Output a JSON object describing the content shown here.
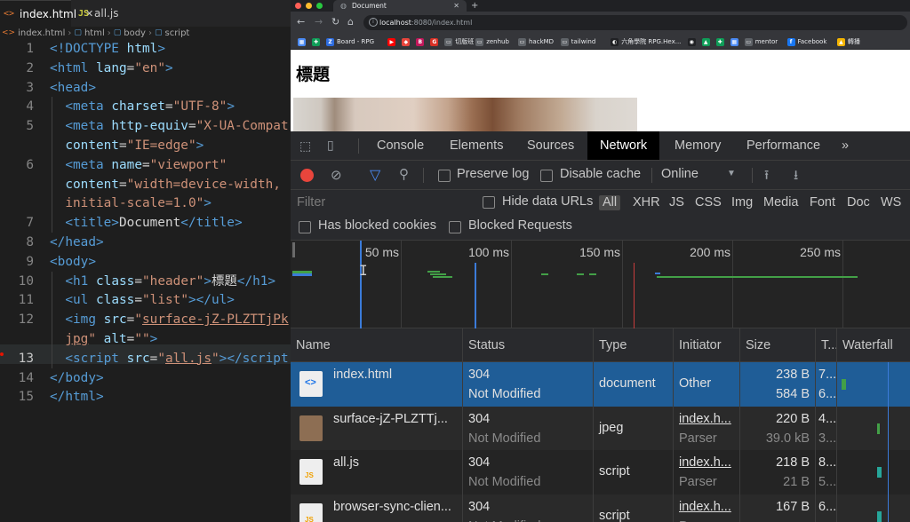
{
  "editor": {
    "tabs": [
      {
        "icon": "<>",
        "label": "index.html",
        "close": "✕"
      },
      {
        "icon": "JS",
        "label": "all.js"
      }
    ],
    "breadcrumb": [
      "index.html",
      "html",
      "body",
      "script"
    ],
    "lines": [
      {
        "n": "1",
        "html": "<span class='t'>&lt;!DOCTYPE</span> <span class='a'>html</span><span class='t'>&gt;</span>"
      },
      {
        "n": "2",
        "html": "<span class='t'>&lt;html</span> <span class='a'>lang</span><span class='x'>=</span><span class='s'>\"en\"</span><span class='t'>&gt;</span>"
      },
      {
        "n": "3",
        "html": "<span class='t'>&lt;head&gt;</span>"
      },
      {
        "n": "4",
        "html": "  <span class='t'>&lt;meta</span> <span class='a'>charset</span><span class='x'>=</span><span class='s'>\"UTF-8\"</span><span class='t'>&gt;</span>"
      },
      {
        "n": "5",
        "html": "  <span class='t'>&lt;meta</span> <span class='a'>http-equiv</span><span class='x'>=</span><span class='s'>\"X-UA-Compat</span>"
      },
      {
        "n": "",
        "html": "  <span class='a'>content</span><span class='x'>=</span><span class='s'>\"IE=edge\"</span><span class='t'>&gt;</span>"
      },
      {
        "n": "6",
        "html": "  <span class='t'>&lt;meta</span> <span class='a'>name</span><span class='x'>=</span><span class='s'>\"viewport\"</span>"
      },
      {
        "n": "",
        "html": "  <span class='a'>content</span><span class='x'>=</span><span class='s'>\"width=device-width,</span>"
      },
      {
        "n": "",
        "html": "  <span class='s'>initial-scale=1.0\"</span><span class='t'>&gt;</span>"
      },
      {
        "n": "7",
        "html": "  <span class='t'>&lt;title&gt;</span><span class='x'>Document</span><span class='t'>&lt;/title&gt;</span>"
      },
      {
        "n": "8",
        "html": "<span class='t'>&lt;/head&gt;</span>"
      },
      {
        "n": "9",
        "html": "<span class='t'>&lt;body&gt;</span>"
      },
      {
        "n": "10",
        "html": "  <span class='t'>&lt;h1</span> <span class='a'>class</span><span class='x'>=</span><span class='s'>\"header\"</span><span class='t'>&gt;</span><span class='x'>標題</span><span class='t'>&lt;/h1&gt;</span>"
      },
      {
        "n": "11",
        "html": "  <span class='t'>&lt;ul</span> <span class='a'>class</span><span class='x'>=</span><span class='s'>\"list\"</span><span class='t'>&gt;&lt;/ul&gt;</span>"
      },
      {
        "n": "12",
        "html": "  <span class='t'>&lt;img</span> <span class='a'>src</span><span class='x'>=</span><span class='s'>\"<u>surface-jZ-PLZTTjPk</u></span>"
      },
      {
        "n": "",
        "html": "  <span class='s'><u>jpg</u>\"</span> <span class='a'>alt</span><span class='x'>=</span><span class='s'>\"\"</span><span class='t'>&gt;</span>"
      },
      {
        "n": "13",
        "html": "  <span class='t'>&lt;script</span> <span class='a'>src</span><span class='x'>=</span><span class='s'>\"<u>all.js</u>\"</span><span class='t'>&gt;&lt;/script</span>"
      },
      {
        "n": "14",
        "html": "<span class='t'>&lt;/body&gt;</span>"
      },
      {
        "n": "15",
        "html": "<span class='t'>&lt;/html&gt;</span>"
      }
    ]
  },
  "browser": {
    "tab_title": "Document",
    "tab_close": "✕",
    "new_tab": "+",
    "url_host": "localhost",
    "url_rest": ":8080/index.html",
    "bookmarks": [
      {
        "label": "",
        "color": "#4a8af4",
        "glyph": "▦"
      },
      {
        "label": "",
        "color": "#0f9d58",
        "glyph": "✚"
      },
      {
        "label": "Board - RPG",
        "color": "#2d6cdf",
        "glyph": "Z"
      },
      {
        "label": "",
        "color": "#ff0000",
        "glyph": "▶"
      },
      {
        "label": "",
        "color": "#e8453c",
        "glyph": "◆"
      },
      {
        "label": "",
        "color": "#c2185b",
        "glyph": "B"
      },
      {
        "label": "",
        "color": "#d93025",
        "glyph": "G"
      },
      {
        "label": "切版班",
        "color": "#5f6368",
        "glyph": "▭"
      },
      {
        "label": "zenhub",
        "color": "#5f6368",
        "glyph": "▭"
      },
      {
        "label": "hackMD",
        "color": "#5f6368",
        "glyph": "▭"
      },
      {
        "label": "tailwind",
        "color": "#5f6368",
        "glyph": "▭"
      },
      {
        "label": "六角學院 RPG.Hex...",
        "color": "#202124",
        "glyph": "◐"
      },
      {
        "label": "",
        "color": "#202124",
        "glyph": "◉"
      },
      {
        "label": "",
        "color": "#0f9d58",
        "glyph": "▲"
      },
      {
        "label": "",
        "color": "#0f9d58",
        "glyph": "✚"
      },
      {
        "label": "",
        "color": "#4a8af4",
        "glyph": "▦"
      },
      {
        "label": "mentor",
        "color": "#5f6368",
        "glyph": "▭"
      },
      {
        "label": "Facebook",
        "color": "#1877f2",
        "glyph": "f"
      },
      {
        "label": "轉播",
        "color": "#f4b400",
        "glyph": "▲"
      }
    ],
    "page": {
      "h1": "標題"
    }
  },
  "devtools": {
    "tabs": [
      "Console",
      "Elements",
      "Sources",
      "Network",
      "Memory",
      "Performance"
    ],
    "active_tab": "Network",
    "more": "»",
    "toolbar": {
      "preserve_log": "Preserve log",
      "disable_cache": "Disable cache",
      "throttling": "Online",
      "throttle_arrow": "▼"
    },
    "filter": {
      "placeholder": "Filter",
      "hide_data_urls": "Hide data URLs",
      "types": [
        "All",
        "XHR",
        "JS",
        "CSS",
        "Img",
        "Media",
        "Font",
        "Doc",
        "WS"
      ],
      "has_blocked_cookies": "Has blocked cookies",
      "blocked_requests": "Blocked Requests"
    },
    "timeline": {
      "ticks": [
        "50 ms",
        "100 ms",
        "150 ms",
        "200 ms",
        "250 ms"
      ]
    },
    "columns": [
      "Name",
      "Status",
      "Type",
      "Initiator",
      "Size",
      "T...",
      "Waterfall"
    ],
    "rows": [
      {
        "name": "index.html",
        "status": "304",
        "status_text": "Not Modified",
        "type": "document",
        "initiator": "Other",
        "initiator_sub": "",
        "size": "238 B",
        "size_sub": "584 B",
        "time": "7...",
        "time_sub": "6...",
        "selected": true,
        "icon": "html-file-icon"
      },
      {
        "name": "surface-jZ-PLZTTj...",
        "status": "304",
        "status_text": "Not Modified",
        "type": "jpeg",
        "initiator": "index.h...",
        "initiator_sub": "Parser",
        "size": "220 B",
        "size_sub": "39.0 kB",
        "time": "4...",
        "time_sub": "3...",
        "selected": false,
        "icon": "image-file-icon"
      },
      {
        "name": "all.js",
        "status": "304",
        "status_text": "Not Modified",
        "type": "script",
        "initiator": "index.h...",
        "initiator_sub": "Parser",
        "size": "218 B",
        "size_sub": "21 B",
        "time": "8...",
        "time_sub": "5...",
        "selected": false,
        "icon": "js-file-icon"
      },
      {
        "name": "browser-sync-clien...",
        "status": "304",
        "status_text": "Not Modified",
        "type": "script",
        "initiator": "index.h...",
        "initiator_sub": "Parser",
        "size": "167 B",
        "size_sub": "",
        "time": "6...",
        "time_sub": "",
        "selected": false,
        "icon": "js-file-icon"
      }
    ]
  }
}
